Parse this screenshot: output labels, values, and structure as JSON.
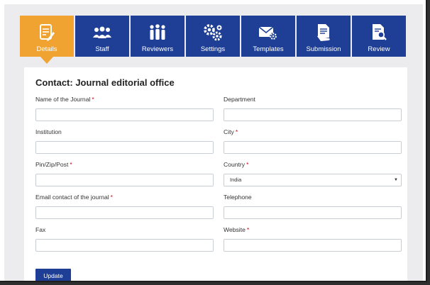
{
  "tabs": [
    {
      "label": "Details",
      "icon": "document-edit-icon"
    },
    {
      "label": "Staff",
      "icon": "people-group-icon"
    },
    {
      "label": "Reviewers",
      "icon": "team-icon"
    },
    {
      "label": "Settings",
      "icon": "gears-icon"
    },
    {
      "label": "Templates",
      "icon": "envelope-gear-icon"
    },
    {
      "label": "Submission",
      "icon": "document-hand-icon"
    },
    {
      "label": "Review",
      "icon": "document-search-icon"
    }
  ],
  "active_tab": "Details",
  "form": {
    "title": "Contact: Journal editorial office",
    "fields": {
      "journal_name": {
        "label": "Name of the Journal",
        "required": "*",
        "value": ""
      },
      "department": {
        "label": "Department",
        "value": ""
      },
      "institution": {
        "label": "Institution",
        "value": ""
      },
      "city": {
        "label": "City",
        "required": "*",
        "value": ""
      },
      "pin": {
        "label": "Pin/Zip/Post",
        "required": "*",
        "value": ""
      },
      "country": {
        "label": "Country",
        "required": "*",
        "value": "India"
      },
      "email": {
        "label": "Email contact of the journal",
        "required": "*",
        "value": ""
      },
      "telephone": {
        "label": "Telephone",
        "value": ""
      },
      "fax": {
        "label": "Fax",
        "value": ""
      },
      "website": {
        "label": "Website",
        "required": "*",
        "value": ""
      }
    },
    "update_label": "Update"
  },
  "colors": {
    "tab_bg": "#1e3f95",
    "tab_active": "#f0a331",
    "required": "#d0021b"
  }
}
